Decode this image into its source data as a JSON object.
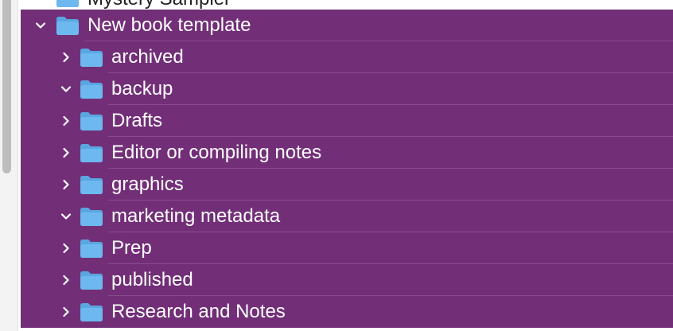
{
  "tree": {
    "partial_row": {
      "label": "Mystery Sampler",
      "icon": "folder-icon"
    },
    "root": {
      "label": "New book template",
      "expanded": true,
      "icon": "folder-icon"
    },
    "children": [
      {
        "label": "archived",
        "expanded": false
      },
      {
        "label": "backup",
        "expanded": true
      },
      {
        "label": "Drafts",
        "expanded": false
      },
      {
        "label": "Editor or compiling notes",
        "expanded": false
      },
      {
        "label": "graphics",
        "expanded": false
      },
      {
        "label": "marketing metadata",
        "expanded": true
      },
      {
        "label": "Prep",
        "expanded": false
      },
      {
        "label": "published",
        "expanded": false
      },
      {
        "label": "Research and Notes",
        "expanded": false
      }
    ]
  },
  "colors": {
    "selection": "#722f78",
    "folder_body": "#6db8ee",
    "folder_tab": "#5aa6e0",
    "text_on_selection": "#ffffff"
  }
}
